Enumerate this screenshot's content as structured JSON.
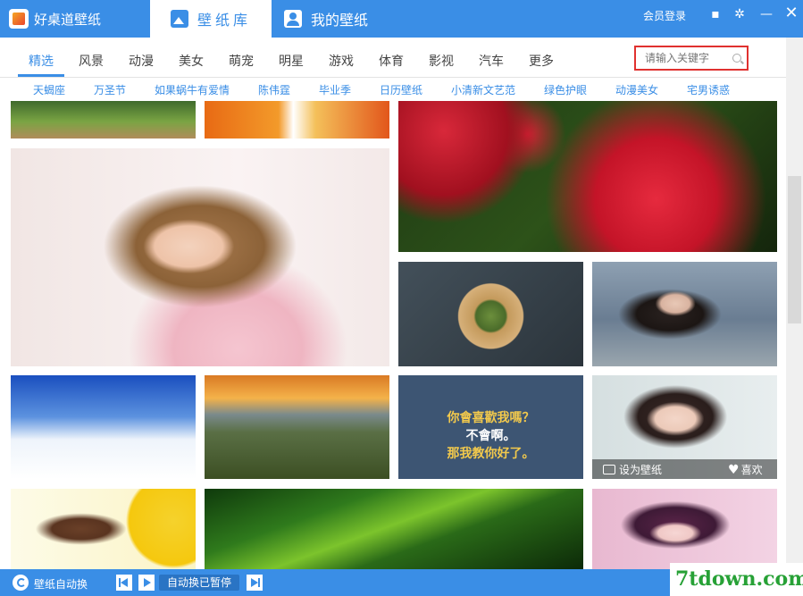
{
  "app": {
    "title": "好桌道壁纸"
  },
  "top_tabs": [
    {
      "label": "壁纸库",
      "active": true
    },
    {
      "label": "我的壁纸",
      "active": false
    }
  ],
  "header": {
    "login": "会员登录",
    "icons": [
      "chat-icon",
      "gear-icon",
      "minimize-icon",
      "close-icon"
    ]
  },
  "categories": [
    "精选",
    "风景",
    "动漫",
    "美女",
    "萌宠",
    "明星",
    "游戏",
    "体育",
    "影视",
    "汽车",
    "更多"
  ],
  "active_category": "精选",
  "search": {
    "placeholder": "请输入关键字"
  },
  "tags": [
    "天蝎座",
    "万圣节",
    "如果蜗牛有爱情",
    "陈伟霆",
    "毕业季",
    "日历壁纸",
    "小清新文艺范",
    "绿色护眼",
    "动漫美女",
    "宅男诱惑"
  ],
  "tiles": {
    "quote_lines": [
      "你會喜歡我嗎？",
      "不會啊。",
      "那我教你好了。"
    ],
    "hover_actions": {
      "set": "设为壁纸",
      "like": "喜欢"
    }
  },
  "bottom": {
    "auto_change": "壁纸自动换",
    "paused": "自动换已暂停"
  },
  "watermark": "7tdown.com",
  "colors": {
    "brand": "#3a8ee6",
    "search_border": "#e0312f",
    "watermark": "#27a136"
  }
}
